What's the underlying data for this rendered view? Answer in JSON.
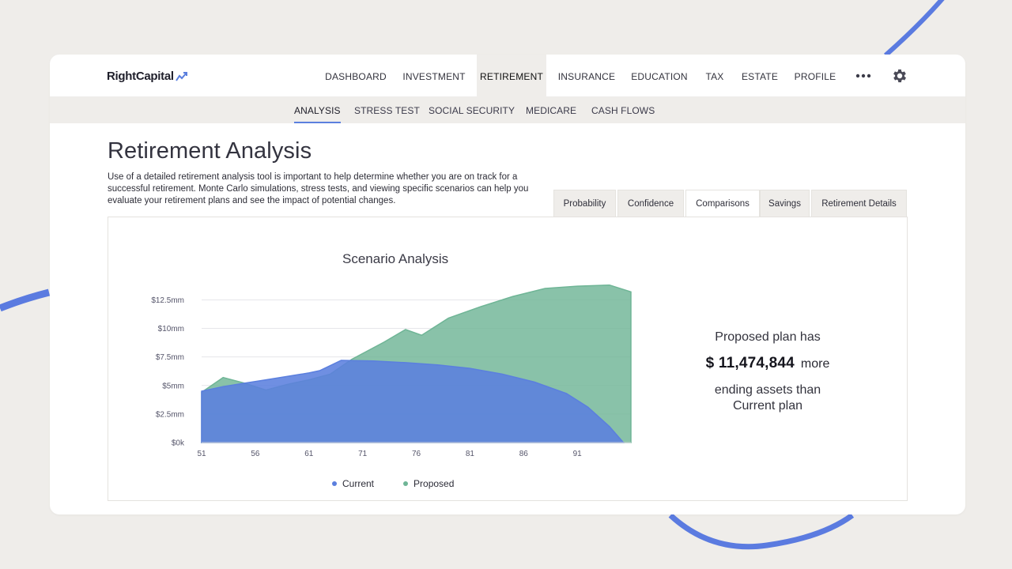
{
  "app": {
    "name": "RightCapital"
  },
  "topnav": {
    "items": [
      {
        "label": "DASHBOARD",
        "active": false
      },
      {
        "label": "INVESTMENT",
        "active": false
      },
      {
        "label": "RETIREMENT",
        "active": true
      },
      {
        "label": "INSURANCE",
        "active": false
      },
      {
        "label": "EDUCATION",
        "active": false
      },
      {
        "label": "TAX",
        "active": false
      },
      {
        "label": "ESTATE",
        "active": false
      },
      {
        "label": "PROFILE",
        "active": false
      }
    ],
    "more_icon": "more-horizontal-icon",
    "settings_icon": "gear-icon"
  },
  "subnav": {
    "items": [
      {
        "label": "ANALYSIS",
        "active": true
      },
      {
        "label": "STRESS TEST",
        "active": false
      },
      {
        "label": "SOCIAL SECURITY",
        "active": false
      },
      {
        "label": "MEDICARE",
        "active": false
      },
      {
        "label": "CASH FLOWS",
        "active": false
      }
    ]
  },
  "page": {
    "title": "Retirement Analysis",
    "description": "Use of a detailed retirement analysis tool is important to help determine whether you are on track for a successful retirement. Monte Carlo simulations, stress tests, and viewing specific scenarios can help you evaluate your retirement plans and see the impact of potential changes."
  },
  "tabs": [
    {
      "label": "Probability",
      "active": false
    },
    {
      "label": "Confidence",
      "active": false
    },
    {
      "label": "Comparisons",
      "active": true
    },
    {
      "label": "Savings",
      "active": false
    },
    {
      "label": "Retirement Details",
      "active": false
    }
  ],
  "summary": {
    "intro": "Proposed plan has",
    "amount": "$ 11,474,844",
    "more": "more",
    "outro_line1": "ending assets than",
    "outro_line2": "Current plan"
  },
  "colors": {
    "accent": "#5b7fde",
    "current": "#5b7fde",
    "proposed": "#6fb596",
    "background": "#efedea"
  },
  "chart_data": {
    "type": "area",
    "title": "Scenario Analysis",
    "xlabel": "",
    "ylabel": "",
    "x_ticks": [
      "51",
      "56",
      "61",
      "71",
      "76",
      "81",
      "86",
      "91"
    ],
    "y_ticks": [
      "$0k",
      "$2.5mm",
      "$5mm",
      "$7.5mm",
      "$10mm",
      "$12.5mm"
    ],
    "ylim": [
      0,
      13500000
    ],
    "xlim": [
      51,
      91
    ],
    "grid": true,
    "legend_position": "bottom",
    "series": [
      {
        "name": "Current",
        "color": "#5b7fde",
        "points": [
          [
            51,
            4500000
          ],
          [
            53,
            4900000
          ],
          [
            55,
            5200000
          ],
          [
            57,
            5500000
          ],
          [
            59,
            5800000
          ],
          [
            61,
            6100000
          ],
          [
            62,
            6300000
          ],
          [
            64,
            7200000
          ],
          [
            67,
            7150000
          ],
          [
            70,
            7000000
          ],
          [
            73,
            6800000
          ],
          [
            76,
            6500000
          ],
          [
            79,
            6000000
          ],
          [
            82,
            5300000
          ],
          [
            85,
            4300000
          ],
          [
            87,
            3100000
          ],
          [
            89,
            1400000
          ],
          [
            90.3,
            0
          ]
        ]
      },
      {
        "name": "Proposed",
        "color": "#6fb596",
        "points": [
          [
            51,
            4400000
          ],
          [
            53,
            5700000
          ],
          [
            55,
            5200000
          ],
          [
            57,
            4600000
          ],
          [
            59,
            5100000
          ],
          [
            61,
            5500000
          ],
          [
            63,
            6000000
          ],
          [
            65,
            7300000
          ],
          [
            68,
            8800000
          ],
          [
            70,
            9900000
          ],
          [
            71.5,
            9400000
          ],
          [
            74,
            10900000
          ],
          [
            77,
            11900000
          ],
          [
            80,
            12800000
          ],
          [
            83,
            13500000
          ],
          [
            86,
            13700000
          ],
          [
            89,
            13800000
          ],
          [
            91,
            13200000
          ]
        ]
      }
    ]
  }
}
